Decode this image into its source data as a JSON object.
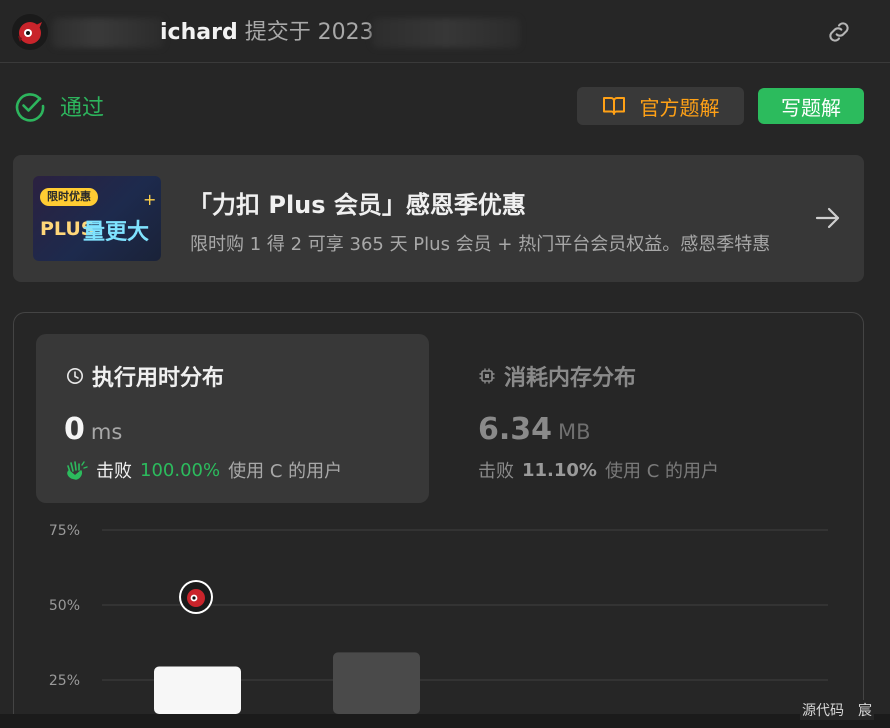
{
  "header": {
    "name_visible": "ichard",
    "submitted_text": "提交于 2023"
  },
  "status": {
    "label": "通过"
  },
  "buttons": {
    "official_solution": "官方题解",
    "write_solution": "写题解"
  },
  "promo": {
    "tag": "限时优惠",
    "image_plus": "PLUS",
    "image_text": "量更大",
    "title": "「力扣 Plus 会员」感恩季优惠",
    "description": "限时购 1 得 2 可享 365 天 Plus 会员 + 热门平台会员权益。感恩季特惠"
  },
  "runtime": {
    "title": "执行用时分布",
    "value": "0",
    "unit": "ms",
    "beat_label": "击败",
    "beat_pct": "100.00%",
    "beat_suffix": "使用 C 的用户"
  },
  "memory": {
    "title": "消耗内存分布",
    "value": "6.34",
    "unit": "MB",
    "beat_label": "击败",
    "beat_pct": "11.10%",
    "beat_suffix": "使用 C 的用户"
  },
  "chart_data": {
    "type": "bar",
    "y_ticks": [
      "75%",
      "50%",
      "25%"
    ],
    "ylim": [
      0,
      75
    ],
    "values": [
      29.5,
      34.2
    ],
    "colors": [
      "#f7f7f7",
      "#4a4a4a"
    ],
    "grid": true
  },
  "footer": {
    "text": "源代码　宸"
  },
  "colors": {
    "accent_green": "#2cbb5d",
    "accent_orange": "#ffa116",
    "background": "#262626"
  }
}
